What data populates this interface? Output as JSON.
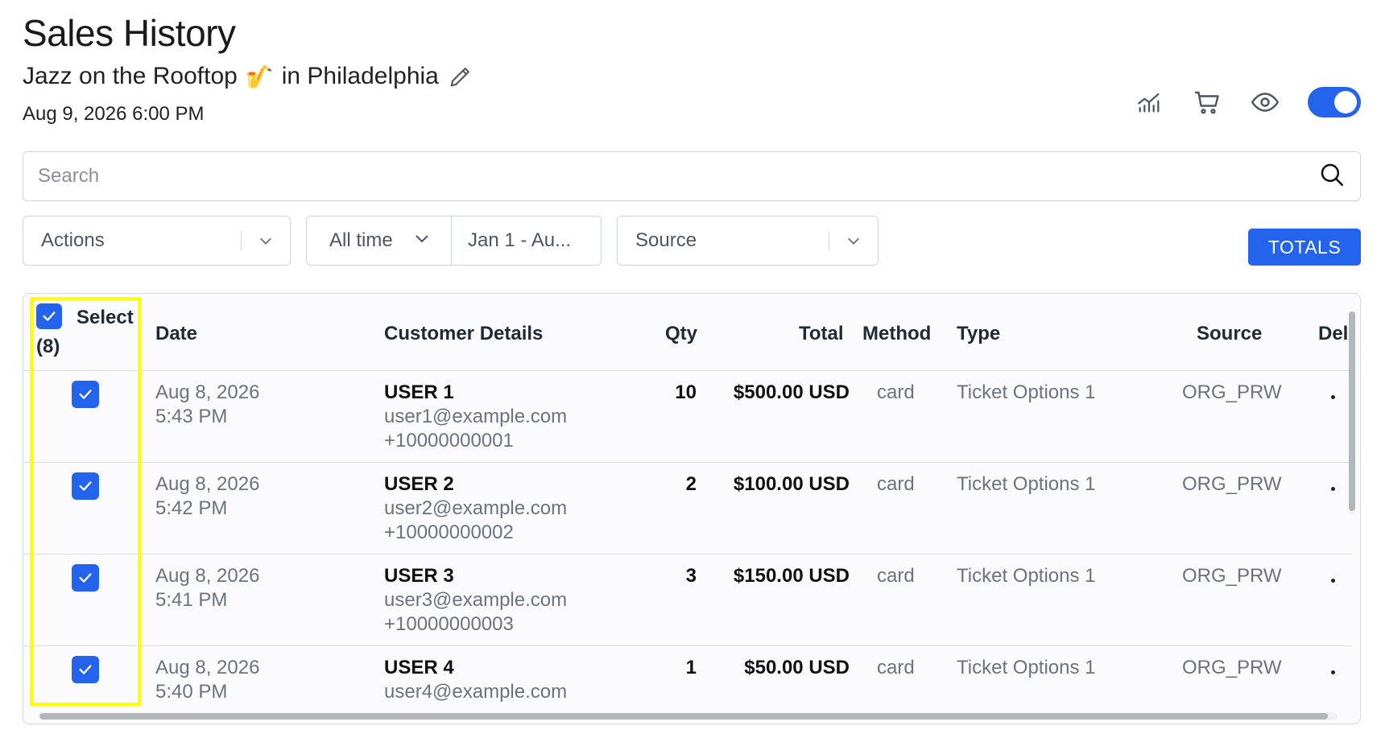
{
  "header": {
    "title": "Sales History",
    "event_name": "Jazz on the Rooftop",
    "event_emoji": "🎷",
    "event_location": "in Philadelphia",
    "event_datetime": "Aug 9, 2026 6:00 PM"
  },
  "toolbar_icons": [
    "chart-icon",
    "cart-icon",
    "eye-icon",
    "toggle-switch"
  ],
  "toggle_on": true,
  "search": {
    "placeholder": "Search",
    "value": ""
  },
  "filters": {
    "actions": "Actions",
    "time_range": "All time",
    "date_range": "Jan 1 - Au...",
    "source": "Source"
  },
  "totals_label": "TOTALS",
  "table": {
    "select_header": "Select",
    "select_count": "(8)",
    "columns": [
      "Date",
      "Customer Details",
      "Qty",
      "Total",
      "Method",
      "Type",
      "Source",
      "Del"
    ],
    "rows": [
      {
        "checked": true,
        "date": "Aug 8, 2026",
        "time": "5:43 PM",
        "name": "USER 1",
        "email": "user1@example.com",
        "phone": "+10000000001",
        "qty": "10",
        "total": "$500.00 USD",
        "method": "card",
        "type": "Ticket Options 1",
        "source": "ORG_PRW"
      },
      {
        "checked": true,
        "date": "Aug 8, 2026",
        "time": "5:42 PM",
        "name": "USER 2",
        "email": "user2@example.com",
        "phone": "+10000000002",
        "qty": "2",
        "total": "$100.00 USD",
        "method": "card",
        "type": "Ticket Options 1",
        "source": "ORG_PRW"
      },
      {
        "checked": true,
        "date": "Aug 8, 2026",
        "time": "5:41 PM",
        "name": "USER 3",
        "email": "user3@example.com",
        "phone": "+10000000003",
        "qty": "3",
        "total": "$150.00 USD",
        "method": "card",
        "type": "Ticket Options 1",
        "source": "ORG_PRW"
      },
      {
        "checked": true,
        "date": "Aug 8, 2026",
        "time": "5:40 PM",
        "name": "USER 4",
        "email": "user4@example.com",
        "phone": "",
        "qty": "1",
        "total": "$50.00 USD",
        "method": "card",
        "type": "Ticket Options 1",
        "source": "ORG_PRW"
      }
    ]
  },
  "colors": {
    "accent": "#2463eb",
    "highlight": "#ffff00"
  }
}
